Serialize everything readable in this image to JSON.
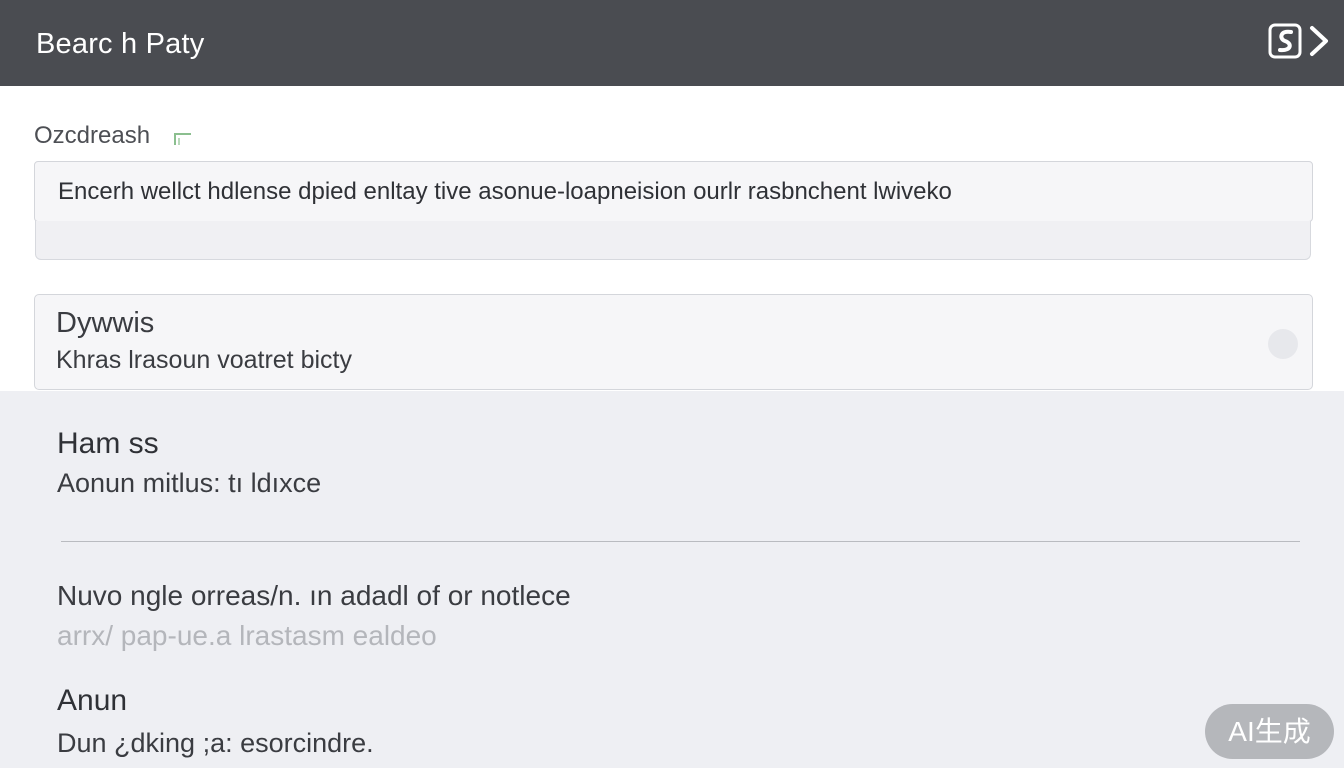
{
  "header": {
    "title": "Bearc h Paty",
    "icon": "search-book-icon"
  },
  "search": {
    "label": "Ozcdreash",
    "value": "Encerh wellct hdlense dpied enltay tive asonue-loapneision ourlr rasbnchent lwiveko"
  },
  "top_result": {
    "title": "Dywwis",
    "subtitle": "Khras lrasoun voatret bicty"
  },
  "entries": [
    {
      "title": "Ham ss",
      "subtitle": "Aonun mitlus: tı ldıxce"
    },
    {
      "line1": "Nuvo ngle orreas/n. ın adadl of or notlece",
      "line2": "arrx/ pap-ue.a lrastasm ealdeo"
    },
    {
      "title": "Anun",
      "subtitle": "Dun ¿dking ;a: esorcindre."
    }
  ],
  "watermark": "AI生成",
  "colors": {
    "header_bg": "#4a4c51",
    "panel_bg": "#eeeff3",
    "card_bg": "#f6f6f8",
    "border": "#d4d6db"
  }
}
